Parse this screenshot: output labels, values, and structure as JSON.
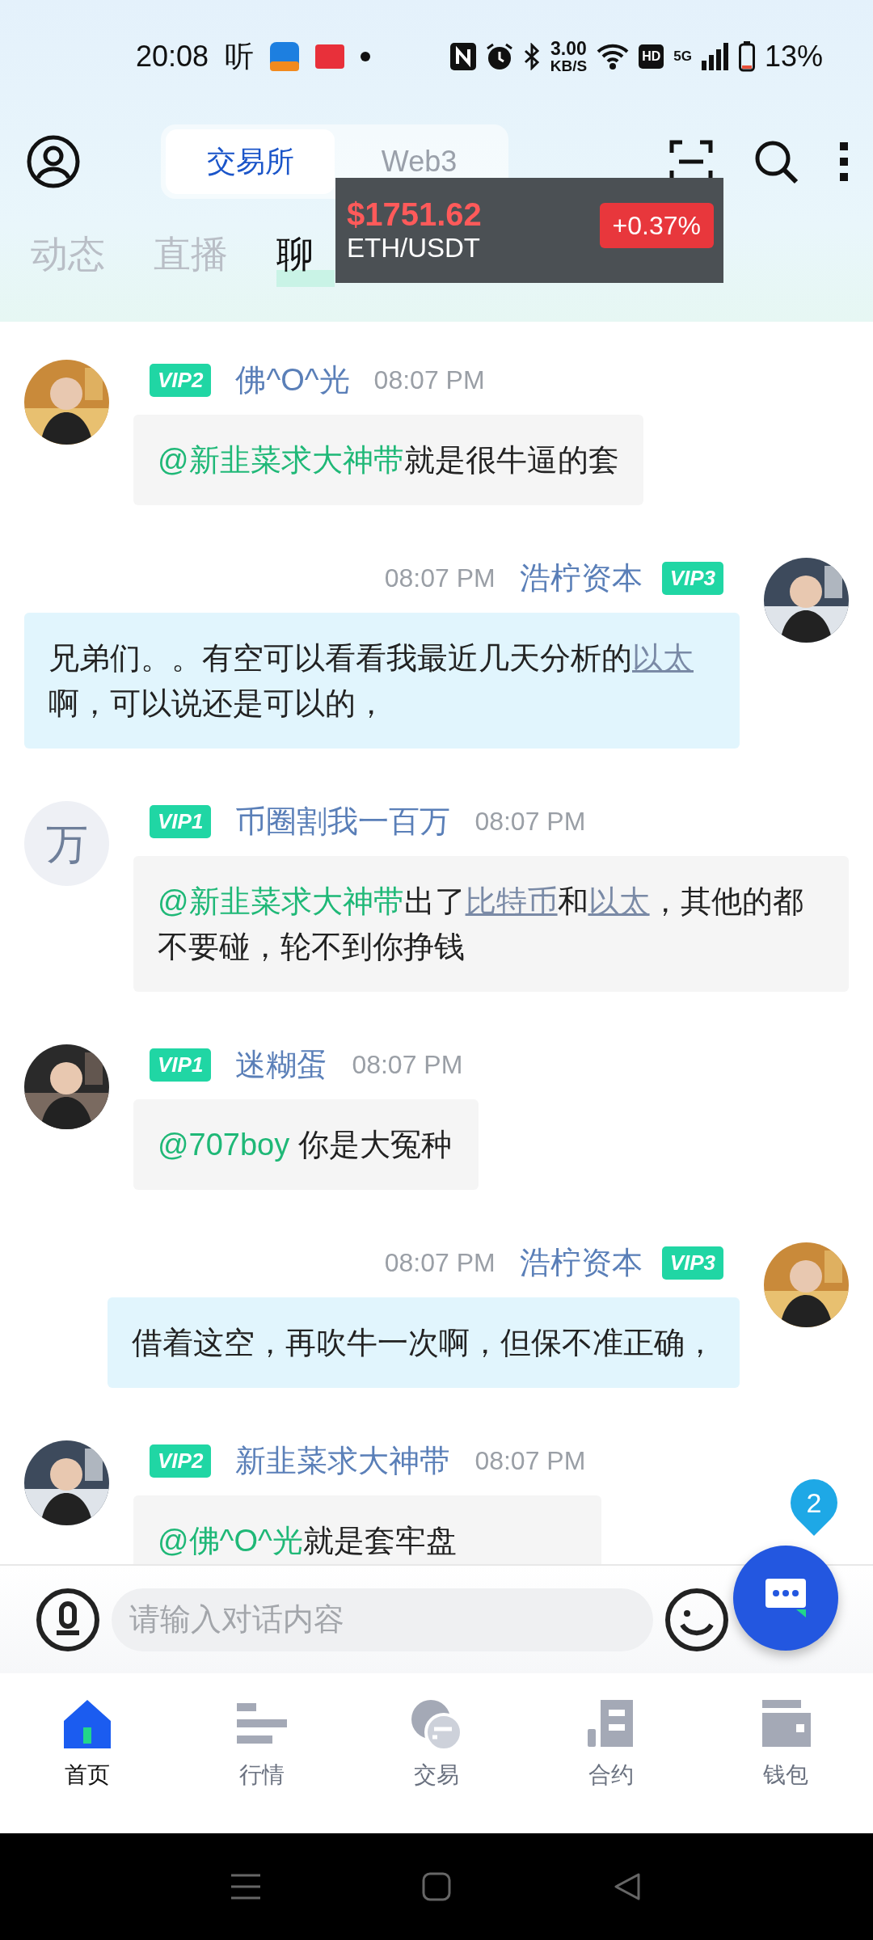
{
  "status_bar": {
    "time": "20:08",
    "app_glyph": "听",
    "speed": "3.00",
    "speed_unit": "KB/S",
    "hd": "HD",
    "network": "5G",
    "battery": "13%"
  },
  "header": {
    "segments": [
      {
        "label": "交易所",
        "selected": true
      },
      {
        "label": "Web3",
        "selected": false
      }
    ]
  },
  "tabs": [
    {
      "label": "动态",
      "selected": false
    },
    {
      "label": "直播",
      "selected": false
    },
    {
      "label": "聊",
      "selected": true
    }
  ],
  "ticker": {
    "price": "$1751.62",
    "pair": "ETH/USDT",
    "change": "+0.37%"
  },
  "messages": [
    {
      "kind": "received",
      "avatar": {
        "kind": "picture"
      },
      "vip": "VIP2",
      "name": "佛^O^光",
      "time": "08:07 PM",
      "parts": [
        {
          "kind": "mention",
          "text": "@新韭菜求大神带"
        },
        {
          "kind": "text",
          "text": "就是很牛逼的套"
        }
      ]
    },
    {
      "kind": "sent",
      "avatar": {
        "kind": "picture"
      },
      "vip": "VIP3",
      "name": "浩柠资本",
      "time": "08:07 PM",
      "parts": [
        {
          "kind": "text",
          "text": "兄弟们。。有空可以看看我最近几天分析的"
        },
        {
          "kind": "link",
          "text": "以太"
        },
        {
          "kind": "text",
          "text": "啊，可以说还是可以的，"
        }
      ]
    },
    {
      "kind": "received",
      "avatar": {
        "kind": "letter",
        "text": "万"
      },
      "vip": "VIP1",
      "name": "币圈割我一百万",
      "time": "08:07 PM",
      "parts": [
        {
          "kind": "mention",
          "text": "@新韭菜求大神带"
        },
        {
          "kind": "text",
          "text": "出了"
        },
        {
          "kind": "link",
          "text": "比特币"
        },
        {
          "kind": "text",
          "text": "和"
        },
        {
          "kind": "link",
          "text": "以太"
        },
        {
          "kind": "text",
          "text": "，其他的都不要碰，轮不到你挣钱"
        }
      ]
    },
    {
      "kind": "received",
      "avatar": {
        "kind": "picture"
      },
      "vip": "VIP1",
      "name": "迷糊蛋",
      "time": "08:07 PM",
      "parts": [
        {
          "kind": "mention",
          "text": "@707boy"
        },
        {
          "kind": "text",
          "text": " 你是大冤种"
        }
      ]
    },
    {
      "kind": "sent",
      "avatar": {
        "kind": "picture"
      },
      "vip": "VIP3",
      "name": "浩柠资本",
      "time": "08:07 PM",
      "parts": [
        {
          "kind": "text",
          "text": "借着这空，再吹牛一次啊，但保不准正确，"
        }
      ]
    },
    {
      "kind": "received",
      "avatar": {
        "kind": "picture"
      },
      "vip": "VIP2",
      "name": "新韭菜求大神带",
      "time": "08:07 PM",
      "parts": [
        {
          "kind": "mention",
          "text": "@佛^O^光"
        },
        {
          "kind": "text",
          "text": "就是套牢盘"
        }
      ]
    }
  ],
  "input": {
    "placeholder": "请输入对话内容"
  },
  "fab": {
    "badge": "2"
  },
  "bottom_nav": [
    {
      "label": "首页",
      "selected": true
    },
    {
      "label": "行情",
      "selected": false
    },
    {
      "label": "交易",
      "selected": false
    },
    {
      "label": "合约",
      "selected": false
    },
    {
      "label": "钱包",
      "selected": false
    }
  ]
}
